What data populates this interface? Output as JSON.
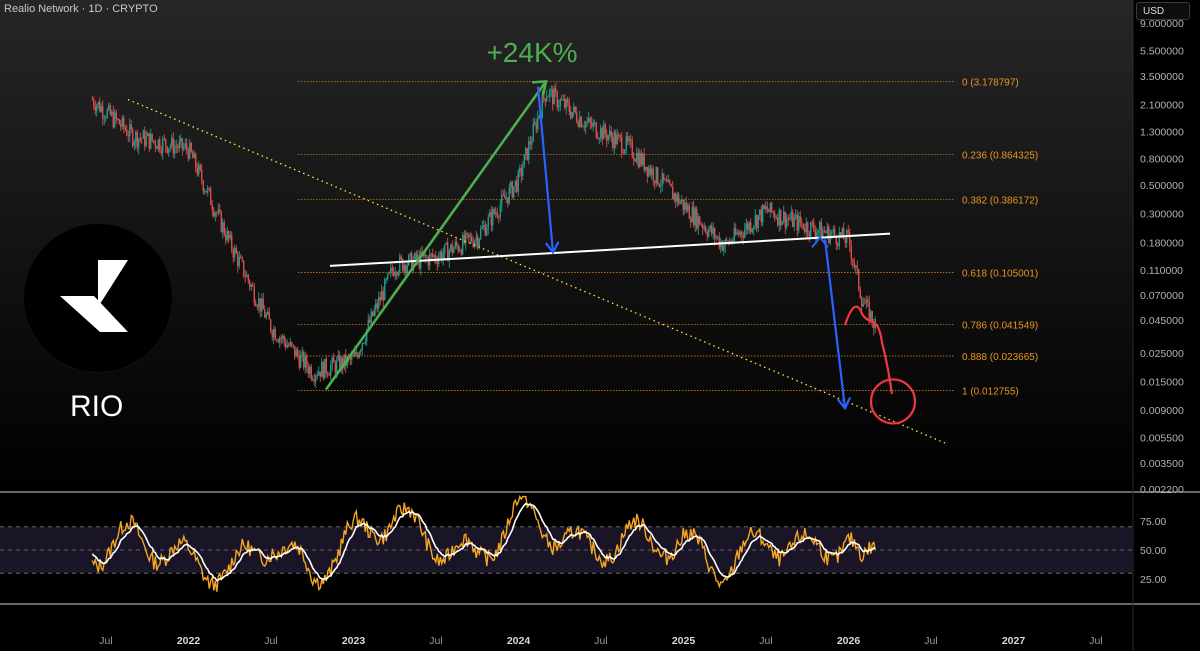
{
  "header": {
    "title": "Realio Network · 1D · CRYPTO",
    "currency": "USD"
  },
  "logo": {
    "ticker": "RIO",
    "icon": "realio-logo-icon"
  },
  "colors": {
    "background": "#000000",
    "candle_up": "#26a69a",
    "candle_down": "#ef5350",
    "fib_line": "#c77a1d",
    "fib_label": "#e89520",
    "trend_up_arrow": "#4caf50",
    "down_arrow": "#2962ff",
    "support_line": "#ffffff",
    "diagonal_support": "#ffeb3b",
    "projection": "#f23645",
    "rsi_line": "#f5a623",
    "rsi_ma": "#ffffff",
    "rsi_band": "#1a1526"
  },
  "chart_data": [
    {
      "type": "line",
      "name": "price",
      "yscale": "log",
      "y_ticks": [
        "9.000000",
        "5.500000",
        "3.500000",
        "2.100000",
        "1.300000",
        "0.800000",
        "0.500000",
        "0.300000",
        "0.180000",
        "0.110000",
        "0.070000",
        "0.045000",
        "0.025000",
        "0.015000",
        "0.009000",
        "0.005500",
        "0.003500",
        "0.002200"
      ],
      "x_ticks": [
        "Jul",
        "2022",
        "Jul",
        "2023",
        "Jul",
        "2024",
        "Jul",
        "2025",
        "Jul",
        "2026",
        "Jul",
        "2027",
        "Jul"
      ],
      "x": [
        "2021-06",
        "2021-09",
        "2022-01",
        "2022-04",
        "2022-07",
        "2022-10",
        "2023-01",
        "2023-04",
        "2023-07",
        "2023-10",
        "2024-01",
        "2024-03",
        "2024-06",
        "2024-09",
        "2025-01",
        "2025-04",
        "2025-07",
        "2025-10",
        "2026-01",
        "2026-02",
        "2026-03"
      ],
      "y": [
        2.3,
        1.2,
        0.95,
        0.18,
        0.04,
        0.018,
        0.022,
        0.12,
        0.14,
        0.2,
        0.55,
        2.7,
        1.5,
        1.0,
        0.35,
        0.17,
        0.32,
        0.24,
        0.19,
        0.065,
        0.04
      ],
      "annotations": {
        "gain_label": "+24K%",
        "fib_levels": [
          {
            "label": "0 (3.178797)",
            "value": 3.178797
          },
          {
            "label": "0.236 (0.864325)",
            "value": 0.864325
          },
          {
            "label": "0.382 (0.386172)",
            "value": 0.386172
          },
          {
            "label": "0.618 (0.105001)",
            "value": 0.105001
          },
          {
            "label": "0.786 (0.041549)",
            "value": 0.041549
          },
          {
            "label": "0.888 (0.023665)",
            "value": 0.023665
          },
          {
            "label": "1 (0.012755)",
            "value": 0.012755
          }
        ]
      }
    },
    {
      "type": "line",
      "name": "rsi",
      "y_ticks": [
        "75.00",
        "50.00",
        "25.00"
      ],
      "ylim": [
        0,
        100
      ],
      "band": [
        30,
        70
      ],
      "x": [
        "2021-06",
        "2021-09",
        "2022-01",
        "2022-04",
        "2022-07",
        "2022-10",
        "2023-01",
        "2023-04",
        "2023-07",
        "2023-10",
        "2024-01",
        "2024-03",
        "2024-06",
        "2024-09",
        "2025-01",
        "2025-04",
        "2025-07",
        "2025-10",
        "2026-01",
        "2026-02",
        "2026-03"
      ],
      "y": [
        48,
        62,
        40,
        30,
        60,
        28,
        62,
        80,
        55,
        42,
        85,
        70,
        48,
        62,
        55,
        32,
        60,
        48,
        60,
        30,
        52
      ]
    }
  ]
}
